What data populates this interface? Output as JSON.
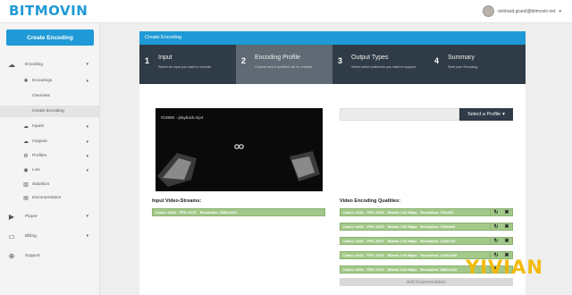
{
  "app": {
    "brand": "BITMOVIN"
  },
  "user": {
    "email": "reinhard.grand@bitmovin.net"
  },
  "sidebar": {
    "create_button": "Create Encoding",
    "items": [
      {
        "label": "Encoding",
        "icon": "cloud-icon"
      },
      {
        "label": "Encodings",
        "icon": "plus-icon"
      },
      {
        "label": "Overview"
      },
      {
        "label": "Create Encoding"
      },
      {
        "label": "Inputs",
        "icon": "cloud-upload-icon"
      },
      {
        "label": "Outputs",
        "icon": "cloud-download-icon"
      },
      {
        "label": "Profiles",
        "icon": "gears-icon"
      },
      {
        "label": "Live",
        "icon": "live-icon"
      },
      {
        "label": "Statistics",
        "icon": "bar-chart-icon"
      },
      {
        "label": "Documentation",
        "icon": "document-icon"
      },
      {
        "label": "Player",
        "icon": "play-icon"
      },
      {
        "label": "Billing",
        "icon": "card-icon"
      },
      {
        "label": "Support",
        "icon": "lifebuoy-icon"
      }
    ]
  },
  "panel": {
    "title": "Create Encoding",
    "steps": [
      {
        "num": "1",
        "title": "Input",
        "desc": "Select an input you want to encode"
      },
      {
        "num": "2",
        "title": "Encoding Profile",
        "desc": "Choose which qualities will be created"
      },
      {
        "num": "3",
        "title": "Output Types",
        "desc": "Select which platforms you want to support"
      },
      {
        "num": "4",
        "title": "Summary",
        "desc": "Start your Encoding"
      }
    ]
  },
  "video": {
    "title": "#1080K - playback.mp4"
  },
  "profile": {
    "button": "Select a Profile"
  },
  "input_streams": {
    "label": "Input Video-Streams:",
    "row": {
      "codec": "Codec: h264",
      "fps": "FPS: 29.97",
      "resolution": "Resolution: 3840x1920"
    }
  },
  "qualities": {
    "label": "Video Encoding Qualities:",
    "rows": [
      {
        "codec": "Codec: h264",
        "fps": "FPS: 29.97",
        "bitrate": "Bitrate: 1.00 Mbps",
        "resolution": "Resolution: 720x360"
      },
      {
        "codec": "Codec: h264",
        "fps": "FPS: 29.97",
        "bitrate": "Bitrate: 1.50 Mbps",
        "resolution": "Resolution: 1080x540"
      },
      {
        "codec": "Codec: h264",
        "fps": "FPS: 29.97",
        "bitrate": "Bitrate: 3.00 Mbps",
        "resolution": "Resolution: 1440x720"
      },
      {
        "codec": "Codec: h264",
        "fps": "FPS: 29.97",
        "bitrate": "Bitrate: 5.00 Mbps",
        "resolution": "Resolution: 2160x1080"
      },
      {
        "codec": "Codec: h264",
        "fps": "FPS: 29.97",
        "bitrate": "Bitrate: 8.00 Mbps",
        "resolution": "Resolution: 2880x1440"
      }
    ],
    "add_label": "Add Representation"
  },
  "watermark": "YIVIAN",
  "colors": {
    "brand": "#1f9ad6",
    "dark": "#2f3b47",
    "green": "#a3c98a",
    "watermark": "#f5b800"
  }
}
